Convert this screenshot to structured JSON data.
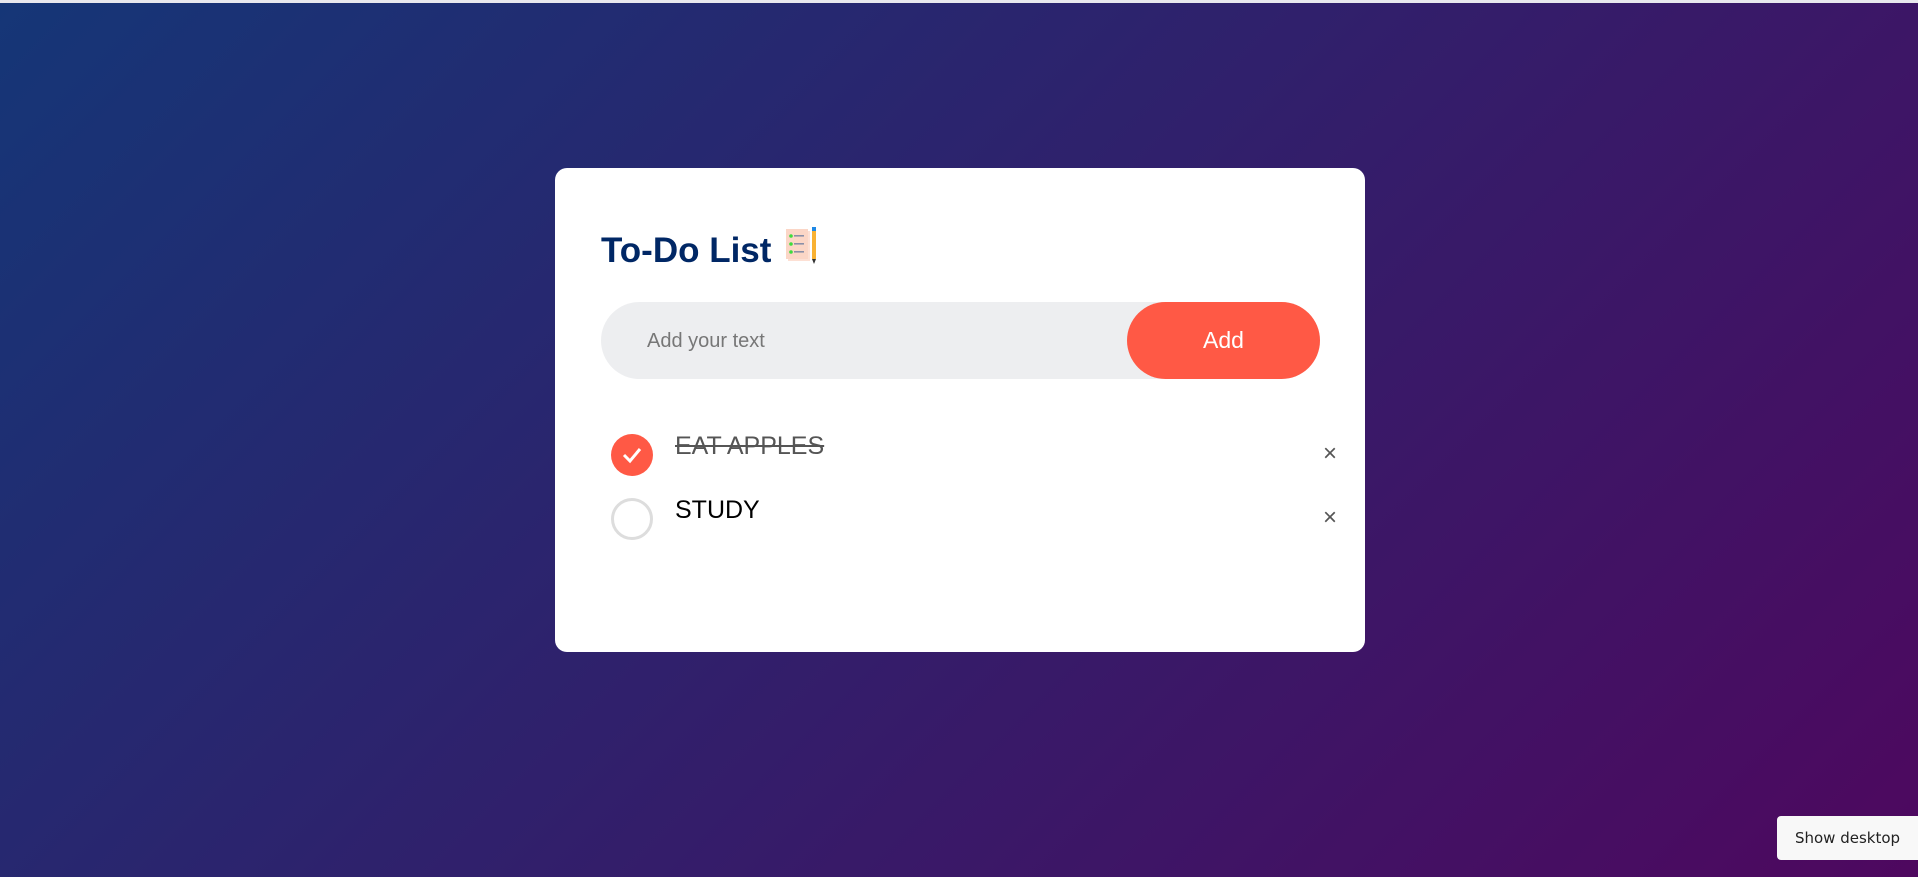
{
  "app": {
    "title": "To-Do List",
    "title_icon": "checklist-pencil-icon",
    "input": {
      "value": "",
      "placeholder": "Add your text"
    },
    "add_label": "Add",
    "tasks": [
      {
        "text": "EAT APPLES",
        "checked": true,
        "delete_label": "×"
      },
      {
        "text": "STUDY",
        "checked": false,
        "delete_label": "×"
      }
    ]
  },
  "taskbar": {
    "show_desktop_label": "Show desktop"
  },
  "colors": {
    "accent": "#ff5945",
    "title": "#002765",
    "gradient_start": "#153677",
    "gradient_end": "#4e085f"
  }
}
